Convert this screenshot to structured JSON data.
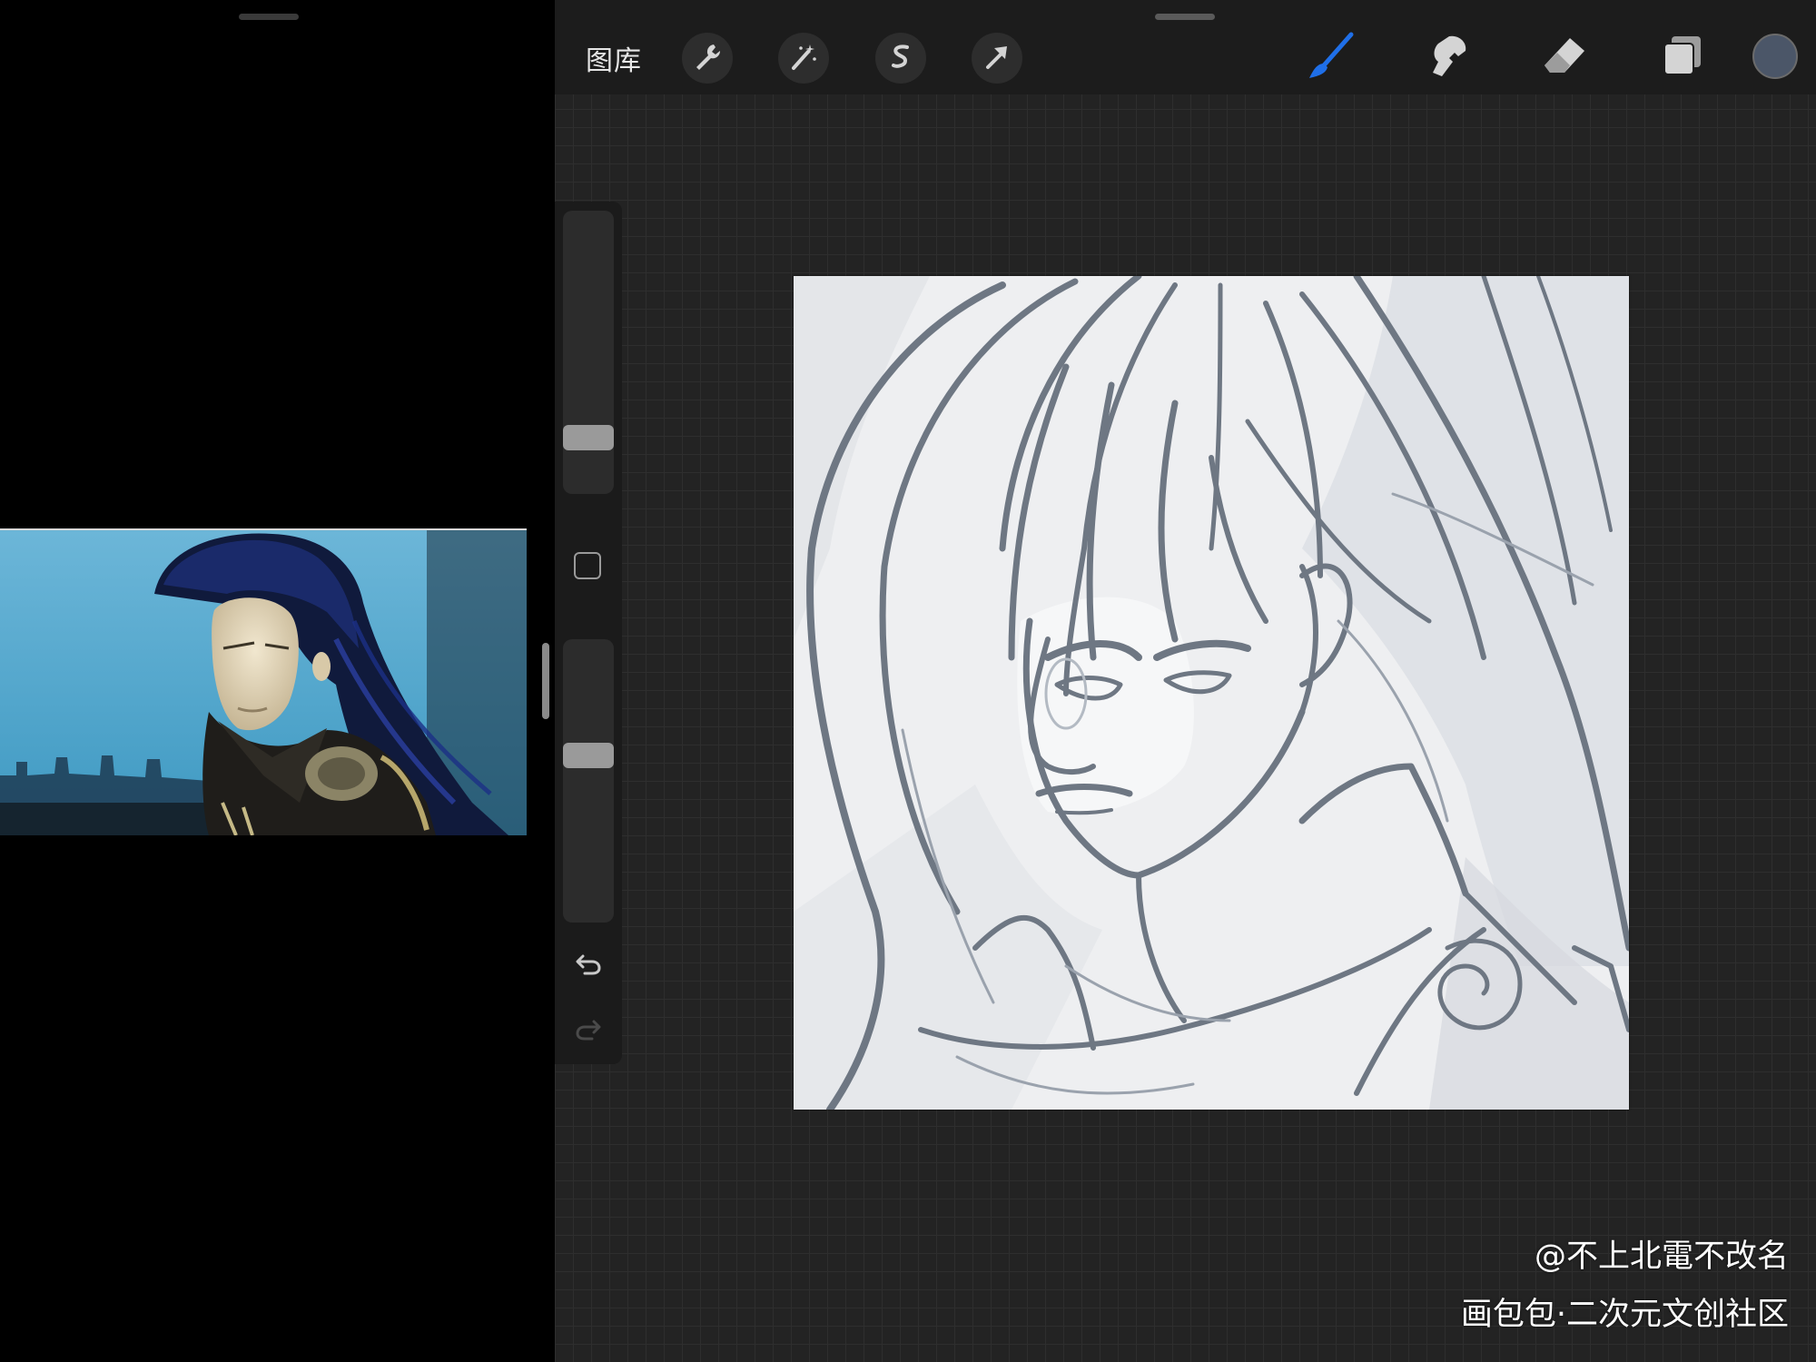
{
  "toolbar": {
    "gallery_label": "图库",
    "left_tools": [
      "wrench-icon",
      "magic-wand-icon",
      "selection-s-icon",
      "transform-arrow-icon"
    ],
    "right_tools": [
      "brush-icon",
      "smudge-icon",
      "eraser-icon",
      "layers-icon"
    ],
    "active_tool": "brush-icon",
    "active_color": "#4b5668",
    "accent_color": "#1f6fe8"
  },
  "sidebar": {
    "brush_size_level": 0.17,
    "opacity_level": 0.6,
    "modify_button_icon": "square-icon",
    "undo_icon": "undo-icon",
    "redo_icon": "redo-icon"
  },
  "watermark": {
    "line1": "@不上北電不改名",
    "line2": "画包包·二次元文创社区"
  }
}
